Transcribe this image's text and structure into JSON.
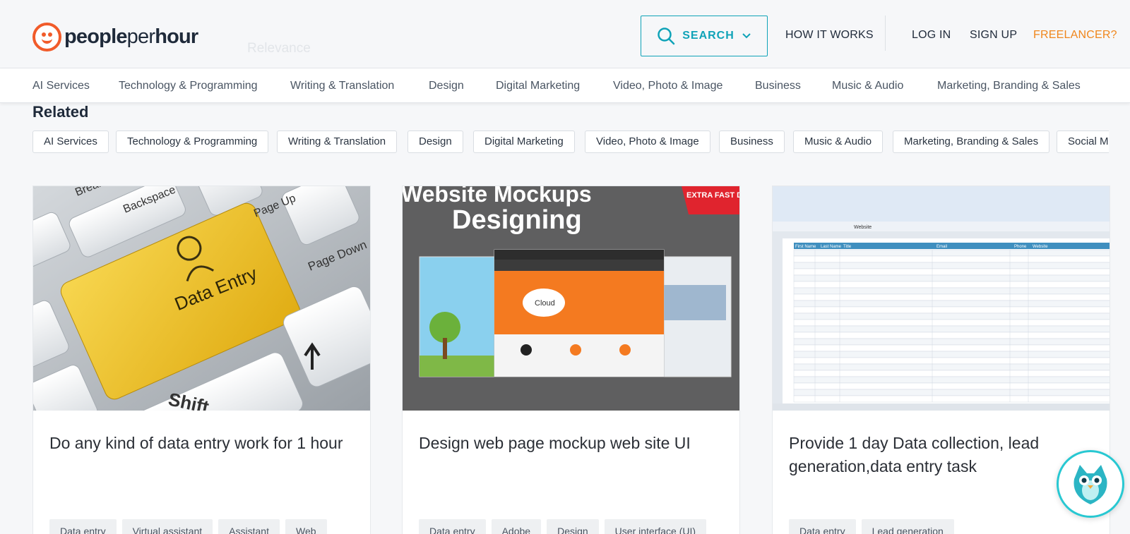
{
  "header": {
    "logo_bold": "people",
    "logo_light": "per",
    "logo_bold2": "hour",
    "ghost_sort": "Relevance",
    "search_label": "SEARCH",
    "how_it_works": "HOW IT WORKS",
    "login": "LOG IN",
    "signup": "SIGN UP",
    "freelancer": "FREELANCER?"
  },
  "categories": [
    "AI Services",
    "Technology & Programming",
    "Writing & Translation",
    "Design",
    "Digital Marketing",
    "Video, Photo & Image",
    "Business",
    "Music & Audio",
    "Marketing, Branding & Sales"
  ],
  "related": {
    "title": "Related",
    "chips": [
      "AI Services",
      "Technology & Programming",
      "Writing & Translation",
      "Design",
      "Digital Marketing",
      "Video, Photo & Image",
      "Business",
      "Music & Audio",
      "Marketing, Branding & Sales",
      "Social Media"
    ]
  },
  "cards": [
    {
      "image_text": "Data Entry",
      "keys": [
        "Break",
        "Backspace",
        "Page Up",
        "Page Down",
        "Shift"
      ],
      "title": "Do any kind of data entry work for 1 hour",
      "tags": [
        "Data entry",
        "Virtual assistant",
        "Assistant",
        "Web"
      ]
    },
    {
      "image_heading_1": "Website Mockups",
      "image_heading_2": "Designing",
      "image_ribbon": "EXTRA FAST DELIVERY",
      "image_cloud": "Cloud",
      "title": "Design web page mockup web site UI",
      "tags": [
        "Data entry",
        "Adobe",
        "Design",
        "User interface (UI)"
      ]
    },
    {
      "image_cell": "Website",
      "sheet_headers": [
        "First Name",
        "Last Name",
        "Title",
        "Email",
        "Phone",
        "Website"
      ],
      "title": "Provide 1 day Data collection, lead generation,data entry task",
      "tags": [
        "Data entry",
        "Lead generation"
      ]
    }
  ],
  "colors": {
    "accent_teal": "#0fa3b8",
    "freelancer_orange": "#f0861c",
    "logo_orange": "#f15b2a",
    "keyboard_yellow": "#f2c633"
  },
  "icons": {
    "search": "search-icon",
    "chevron": "chevron-down-icon",
    "chat": "chat-bot-icon"
  }
}
